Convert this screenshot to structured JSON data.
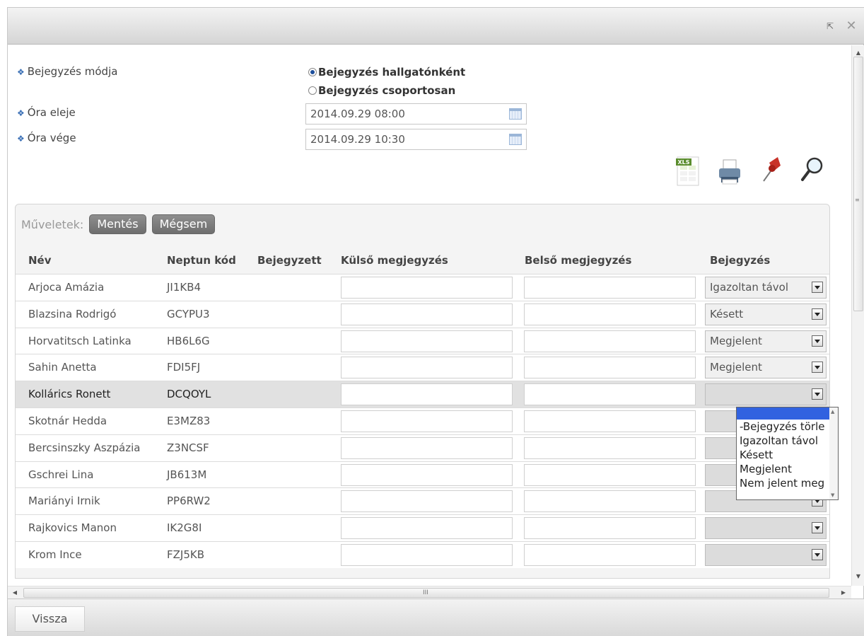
{
  "form": {
    "mode_label": "Bejegyzés módja",
    "mode_options": [
      "Bejegyzés hallgatónként",
      "Bejegyzés csoportosan"
    ],
    "mode_selected": 0,
    "start_label": "Óra eleje",
    "start_value": "2014.09.29 08:00",
    "end_label": "Óra vége",
    "end_value": "2014.09.29 10:30"
  },
  "toolbar": {
    "icons": [
      "xls-export-icon",
      "print-icon",
      "pin-icon",
      "search-icon"
    ],
    "xls_text": "XLS"
  },
  "ops": {
    "label": "Műveletek:",
    "save": "Mentés",
    "cancel": "Mégsem"
  },
  "table": {
    "headers": [
      "Név",
      "Neptun kód",
      "Bejegyzett",
      "Külső megjegyzés",
      "Belső megjegyzés",
      "Bejegyzés"
    ],
    "rows": [
      {
        "name": "Arjoca Amázia",
        "code": "JI1KB4",
        "entry": "Igazoltan távol"
      },
      {
        "name": "Blazsina Rodrigó",
        "code": "GCYPU3",
        "entry": "Késett"
      },
      {
        "name": "Horvatitsch Latinka",
        "code": "HB6L6G",
        "entry": "Megjelent"
      },
      {
        "name": "Sahin Anetta",
        "code": "FDI5FJ",
        "entry": "Megjelent"
      },
      {
        "name": "Kollárics Ronett",
        "code": "DCQOYL",
        "entry": ""
      },
      {
        "name": "Skotnár Hedda",
        "code": "E3MZ83",
        "entry": ""
      },
      {
        "name": "Bercsinszky Aszpázia",
        "code": "Z3NCSF",
        "entry": ""
      },
      {
        "name": "Gschrei Lina",
        "code": "JB613M",
        "entry": ""
      },
      {
        "name": "Mariányi Irnik",
        "code": "PP6RW2",
        "entry": ""
      },
      {
        "name": "Rajkovics Manon",
        "code": "IK2G8I",
        "entry": ""
      },
      {
        "name": "Krom Ince",
        "code": "FZJ5KB",
        "entry": ""
      }
    ],
    "selected_row": 4
  },
  "dropdown": {
    "options": [
      "",
      "-Bejegyzés törle",
      "Igazoltan távol",
      "Késett",
      "Megjelent",
      "Nem jelent meg"
    ]
  },
  "footer": {
    "back": "Vissza"
  },
  "colors": {
    "accent": "#3162e0",
    "button_gray": "#7a7a7a",
    "selected_row": "#e1e1e1"
  }
}
